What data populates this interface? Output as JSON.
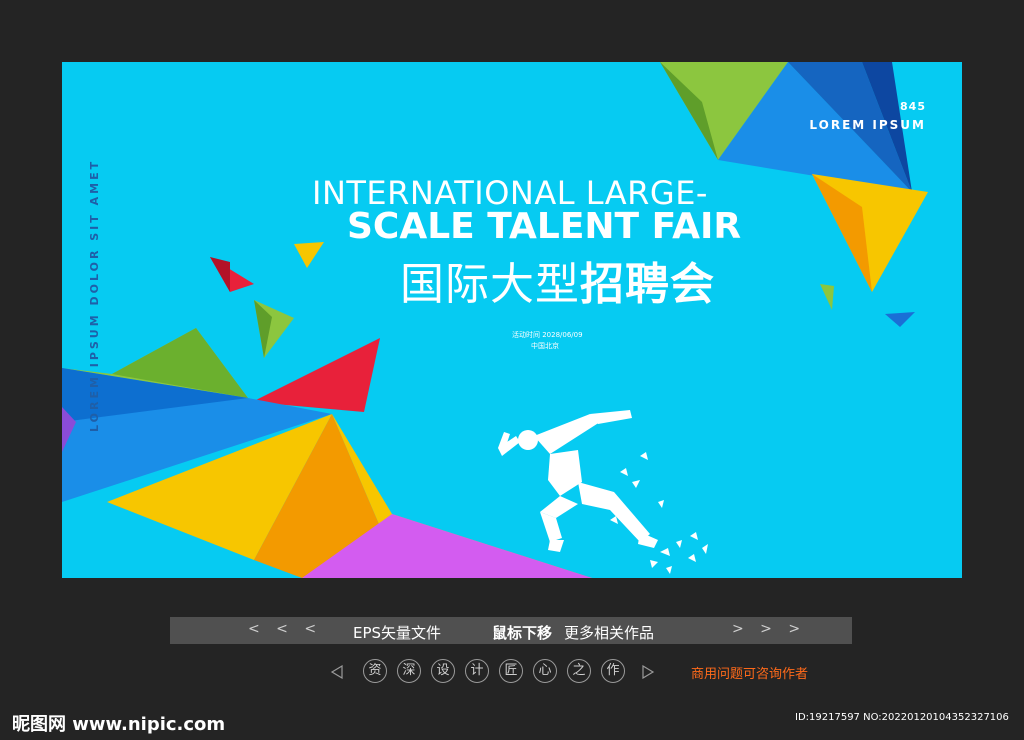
{
  "poster": {
    "vertical_text": "LOREM IPSUM DOLOR SIT AMET",
    "corner_number": "845",
    "corner_text": "LOREM IPSUM",
    "title_line1": "INTERNATIONAL LARGE-",
    "title_line2": "SCALE TALENT FAIR",
    "title_cn_light": "国际大型",
    "title_cn_bold": "招聘会",
    "event_time": "活动时间 2028/06/09",
    "event_place": "中国北京",
    "colors": {
      "background": "#06cbf2",
      "yellow": "#f7c600",
      "green": "#8cc63f",
      "blue": "#1a8ee8",
      "red": "#e8213a",
      "purple": "#d35cf0"
    }
  },
  "footer": {
    "nav_left": "< < <",
    "nav_right": "> > >",
    "file_type": "EPS矢量文件",
    "hover_bold": "鼠标下移",
    "hover_rest": "更多相关作品",
    "chars": [
      "资",
      "深",
      "设",
      "计",
      "匠",
      "心",
      "之",
      "作"
    ],
    "contact": "商用问题可咨询作者",
    "site_logo": "昵图网 www.nipic.com",
    "image_id": "ID:19217597 NO:20220120104352327106"
  }
}
